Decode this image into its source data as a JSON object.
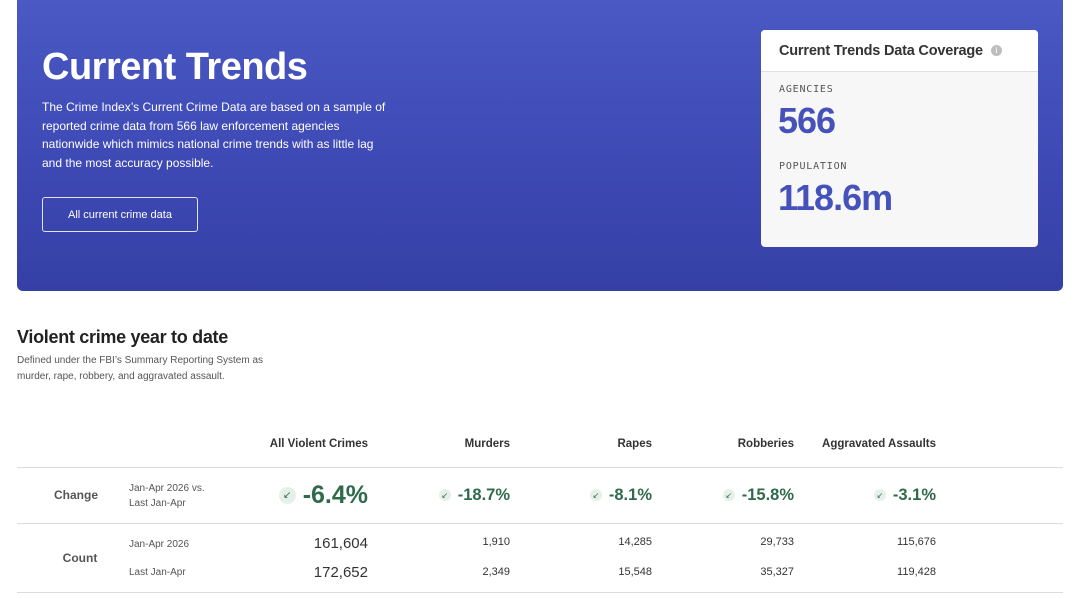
{
  "hero": {
    "title": "Current Trends",
    "description": "The Crime Index’s Current Crime Data are based on a sample of reported crime data from 566 law enforcement agencies nationwide which mimics national crime trends with as little lag and the most accuracy possible.",
    "button_label": "All current crime data",
    "background_color": "#4050b8"
  },
  "coverage": {
    "title": "Current Trends Data Coverage",
    "info_icon": "info-icon",
    "agencies_label": "AGENCIES",
    "agencies_value": "566",
    "population_label": "POPULATION",
    "population_value": "118.6m",
    "value_color": "#4552b9"
  },
  "section": {
    "title": "Violent crime year to date",
    "description": "Defined under the FBI’s Summary Reporting System as murder, rape, robbery, and aggravated assault."
  },
  "table": {
    "columns": [
      "All Violent Crimes",
      "Murders",
      "Rapes",
      "Robberies",
      "Aggravated Assaults"
    ],
    "change_row": {
      "label": "Change",
      "period_line1": "Jan-Apr 2026 vs.",
      "period_line2": "Last Jan-Apr",
      "values": [
        "-6.4%",
        "-18.7%",
        "-8.1%",
        "-15.8%",
        "-3.1%"
      ],
      "arrow_icon": "arrow-down-left-icon",
      "arrow_glyph": "↙",
      "color": "#2f6b4a"
    },
    "count_row": {
      "label": "Count",
      "period_current": "Jan-Apr 2026",
      "period_previous": "Last Jan-Apr",
      "current_values": [
        "161,604",
        "1,910",
        "14,285",
        "29,733",
        "115,676"
      ],
      "previous_values": [
        "172,652",
        "2,349",
        "15,548",
        "35,327",
        "119,428"
      ]
    }
  }
}
